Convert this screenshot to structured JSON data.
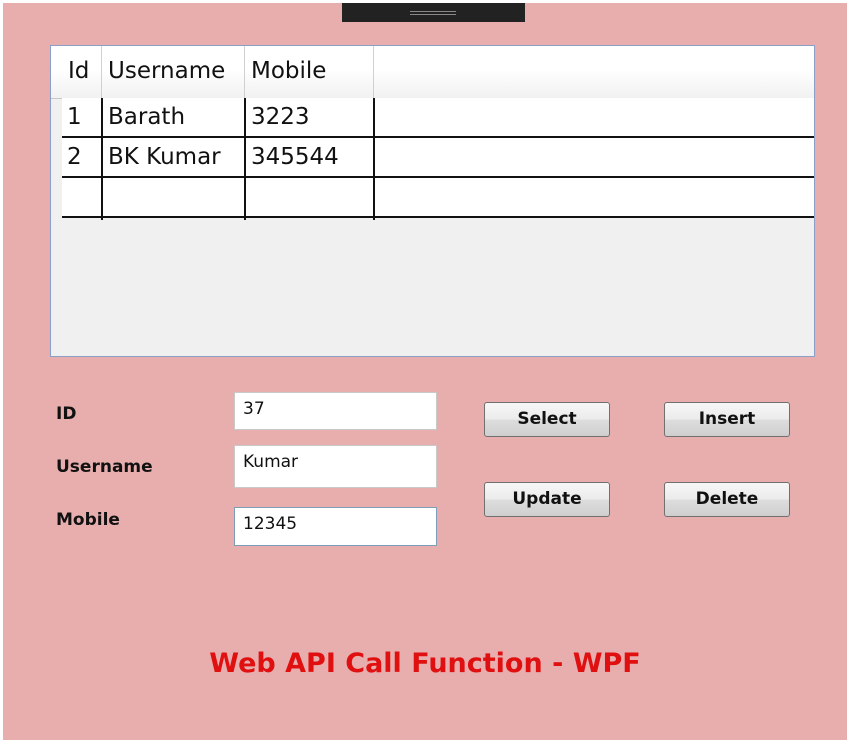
{
  "grid": {
    "columns": [
      "Id",
      "Username",
      "Mobile"
    ],
    "rows": [
      [
        "1",
        "Barath",
        "3223"
      ],
      [
        "2",
        "BK Kumar",
        "345544"
      ],
      [
        "",
        "",
        ""
      ]
    ]
  },
  "form": {
    "id_label": "ID",
    "username_label": "Username",
    "mobile_label": "Mobile",
    "id_value": "37",
    "username_value": "Kumar",
    "mobile_value": "12345"
  },
  "buttons": {
    "select": "Select",
    "insert": "Insert",
    "update": "Update",
    "delete": "Delete"
  },
  "footer": {
    "title": "Web API Call Function - WPF"
  },
  "colors": {
    "window_background": "#e8aeae",
    "title_color": "#e01010"
  }
}
